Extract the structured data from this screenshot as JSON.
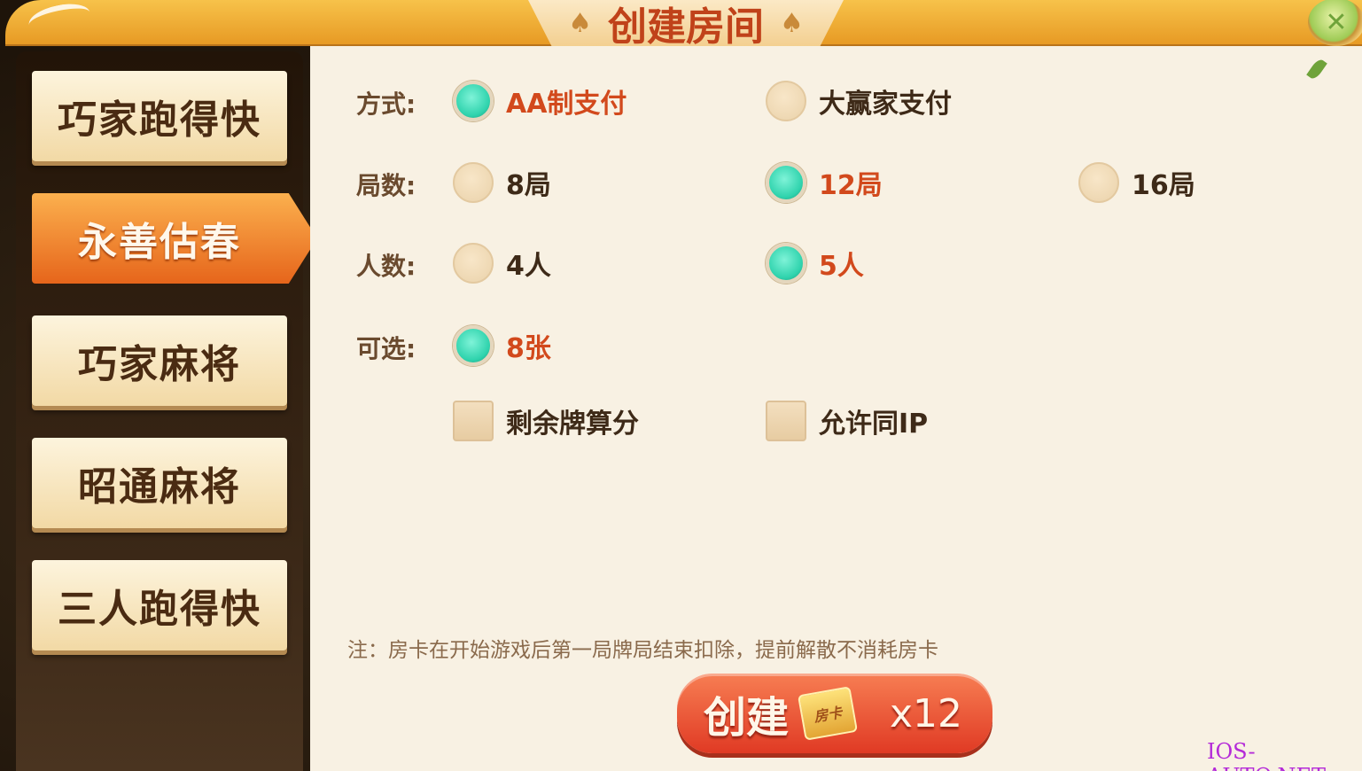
{
  "dialog": {
    "title": "创建房间"
  },
  "sidebar": {
    "items": [
      {
        "label": "巧家跑得快",
        "active": false
      },
      {
        "label": "永善估春",
        "active": true
      },
      {
        "label": "巧家麻将",
        "active": false
      },
      {
        "label": "昭通麻将",
        "active": false
      },
      {
        "label": "三人跑得快",
        "active": false
      }
    ]
  },
  "options": {
    "payment": {
      "label": "方式:",
      "choices": [
        {
          "text": "AA制支付",
          "selected": true
        },
        {
          "text": "大赢家支付",
          "selected": false
        }
      ]
    },
    "rounds": {
      "label": "局数:",
      "choices": [
        {
          "text": "8局",
          "selected": false
        },
        {
          "text": "12局",
          "selected": true
        },
        {
          "text": "16局",
          "selected": false
        }
      ]
    },
    "players": {
      "label": "人数:",
      "choices": [
        {
          "text": "4人",
          "selected": false
        },
        {
          "text": "5人",
          "selected": true
        }
      ]
    },
    "optional": {
      "label": "可选:",
      "choices": [
        {
          "text": "8张",
          "selected": true
        }
      ],
      "checkboxes": [
        {
          "text": "剩余牌算分",
          "checked": false
        },
        {
          "text": "允许同IP",
          "checked": false
        }
      ]
    }
  },
  "note": "注：房卡在开始游戏后第一局牌局结束扣除，提前解散不消耗房卡",
  "create_button": {
    "label": "创建",
    "card_icon_text": "房卡",
    "count": "x12"
  },
  "watermark": "IOS-AUTO.NET",
  "colors": {
    "accent": "#e6651b",
    "selected_radio": "#2fd3ad",
    "selected_text": "#d2491c",
    "panel_bg": "#f8f1e3"
  },
  "icons": {
    "close": "close-icon",
    "title_ornament": "spade-icon"
  }
}
